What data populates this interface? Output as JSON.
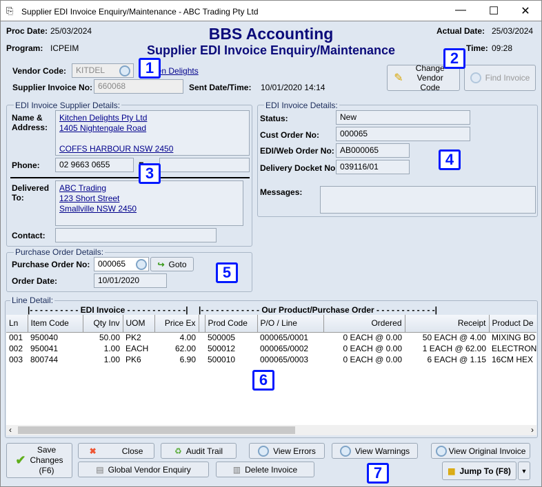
{
  "window": {
    "title": "Supplier EDI Invoice Enquiry/Maintenance - ABC Trading Pty Ltd"
  },
  "header": {
    "proc_date_label": "Proc Date:",
    "proc_date": "25/03/2024",
    "program_label": "Program:",
    "program": "ICPEIM",
    "app_title": "BBS Accounting",
    "screen_title": "Supplier EDI Invoice Enquiry/Maintenance",
    "actual_date_label": "Actual Date:",
    "actual_date": "25/03/2024",
    "time_label": "Time:",
    "time": "09:28"
  },
  "vendor": {
    "code_label": "Vendor Code:",
    "code": "KITDEL",
    "name_link": "Kitchen Delights",
    "invoice_label": "Supplier Invoice No:",
    "invoice": "660068",
    "sent_label": "Sent Date/Time:",
    "sent": "10/01/2020 14:14",
    "change_btn": "Change Vendor Code",
    "find_btn": "Find Invoice"
  },
  "supplier": {
    "legend": "EDI Invoice Supplier Details:",
    "name_label": "Name & Address:",
    "address": [
      "Kitchen Delights Pty Ltd",
      "1405 Nightengale Road",
      "",
      "COFFS HARBOUR NSW 2450"
    ],
    "phone_label": "Phone:",
    "phone": "02 9663 0655",
    "fax_label": "Fax:",
    "fax": "",
    "delivered_label": "Delivered To:",
    "delivered": [
      "ABC Trading",
      "123 Short Street",
      "Smallville NSW 2450"
    ],
    "contact_label": "Contact:",
    "contact": ""
  },
  "invoice": {
    "legend": "EDI Invoice Details:",
    "status_label": "Status:",
    "status": "New",
    "cust_order_label": "Cust Order No:",
    "cust_order": "000065",
    "web_order_label": "EDI/Web Order No:",
    "web_order": "AB000065",
    "docket_label": "Delivery Docket No:",
    "docket": "039116/01",
    "messages_label": "Messages:",
    "messages": ""
  },
  "po": {
    "legend": "Purchase Order Details:",
    "po_label": "Purchase Order No:",
    "po": "000065",
    "goto": "Goto",
    "date_label": "Order Date:",
    "date": "10/01/2020"
  },
  "lines": {
    "legend": "Line Detail:",
    "group1": "|- - - - - - - - - - EDI Invoice - - - - - - - - - - - -|",
    "group2": "|- - - - - - - - - - - - Our Product/Purchase Order - - - - - - - - - - - -|",
    "columns": [
      "Ln",
      "Item Code",
      "Qty Inv",
      "UOM",
      "Price Ex",
      "",
      "Prod Code",
      "P/O / Line",
      "Ordered",
      "Receipt",
      "Product De"
    ],
    "rows": [
      [
        "001",
        "950040",
        "50.00",
        "PK2",
        "4.00",
        "",
        "500005",
        "000065/0001",
        "0 EACH @ 0.00",
        "50 EACH @ 4.00",
        "MIXING BO"
      ],
      [
        "002",
        "950041",
        "1.00",
        "EACH",
        "62.00",
        "",
        "500012",
        "000065/0002",
        "0 EACH @ 0.00",
        "1 EACH @ 62.00",
        "ELECTRON"
      ],
      [
        "003",
        "800744",
        "1.00",
        "PK6",
        "6.90",
        "",
        "500010",
        "000065/0003",
        "0 EACH @ 0.00",
        "6 EACH @ 1.15",
        "16CM HEX"
      ]
    ]
  },
  "buttons": {
    "save": [
      "Save",
      "Changes",
      "(F6)"
    ],
    "close": "Close",
    "audit": "Audit Trail",
    "errors": "View Errors",
    "warnings": "View Warnings",
    "original": "View Original Invoice",
    "global": "Global Vendor Enquiry",
    "delete": "Delete Invoice",
    "jump": "Jump To (F8)"
  },
  "badges": [
    "1",
    "2",
    "3",
    "4",
    "5",
    "6",
    "7"
  ],
  "colors": {
    "title": "#0b0b7a",
    "badge": "#0019ff",
    "link": "#00008b"
  }
}
